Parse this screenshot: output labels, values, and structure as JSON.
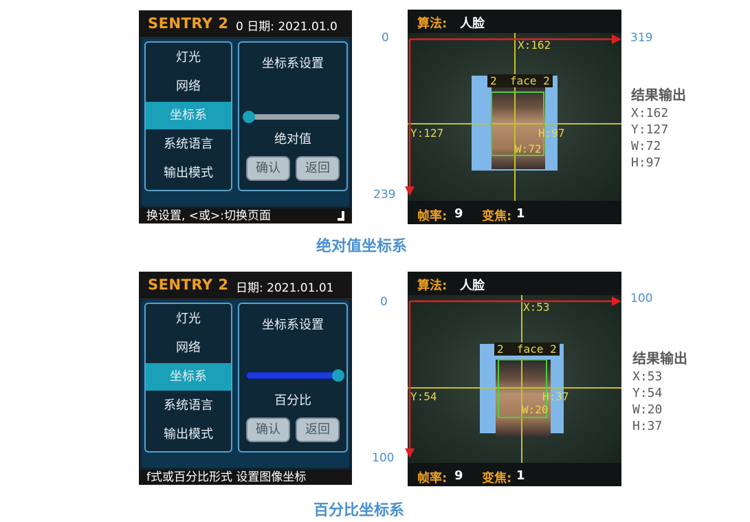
{
  "panels": [
    {
      "device": {
        "brand": "SENTRY 2",
        "date_text": "0 日期: 2021.01.0",
        "menu_items": [
          "灯光",
          "网络",
          "坐标系",
          "系统语言",
          "输出模式"
        ],
        "active_index": 2,
        "settings_title": "坐标系设置",
        "mode_label": "绝对值",
        "slider_value": 0,
        "confirm_label": "确认",
        "back_label": "返回",
        "footer_text": "换设置, <或>:切换页面"
      },
      "camera": {
        "algo_label": "算法:",
        "algo_value": "人脸",
        "fps_label": "帧率:",
        "fps_value": "9",
        "zoom_label": "变焦:",
        "zoom_value": "1",
        "x_label": "X:162",
        "y_label": "Y:127",
        "w_label": "W:72",
        "h_label": "H:97",
        "id_label": "2",
        "face_label": "face 2"
      },
      "axis": {
        "origin": "0",
        "x_max": "319",
        "y_max": "239"
      },
      "result": {
        "title": "结果输出",
        "x": "X:162",
        "y": "Y:127",
        "w": "W:72",
        "h": "H:97"
      },
      "caption": "绝对值坐标系"
    },
    {
      "device": {
        "brand": "SENTRY 2",
        "date_text": "日期: 2021.01.01",
        "menu_items": [
          "灯光",
          "网络",
          "坐标系",
          "系统语言",
          "输出模式"
        ],
        "active_index": 2,
        "settings_title": "坐标系设置",
        "mode_label": "百分比",
        "slider_value": 1,
        "confirm_label": "确认",
        "back_label": "返回",
        "footer_text": "f式或百分比形式  设置图像坐标"
      },
      "camera": {
        "algo_label": "算法:",
        "algo_value": "人脸",
        "fps_label": "帧率:",
        "fps_value": "9",
        "zoom_label": "变焦:",
        "zoom_value": "1",
        "x_label": "X:53",
        "y_label": "Y:54",
        "w_label": "W:20",
        "h_label": "H:37",
        "id_label": "2",
        "face_label": "face 2"
      },
      "axis": {
        "origin": "0",
        "x_max": "100",
        "y_max": "100"
      },
      "result": {
        "title": "结果输出",
        "x": "X:53",
        "y": "Y:54",
        "w": "W:20",
        "h": "H:37"
      },
      "caption": "百分比坐标系"
    }
  ],
  "colors": {
    "brand": "#f0a020",
    "accent": "#1aa0b8",
    "annotation": "#4a90d0",
    "axis_arrow": "#e02020",
    "crosshair": "#c8c028",
    "face_box": "#4ad040"
  }
}
